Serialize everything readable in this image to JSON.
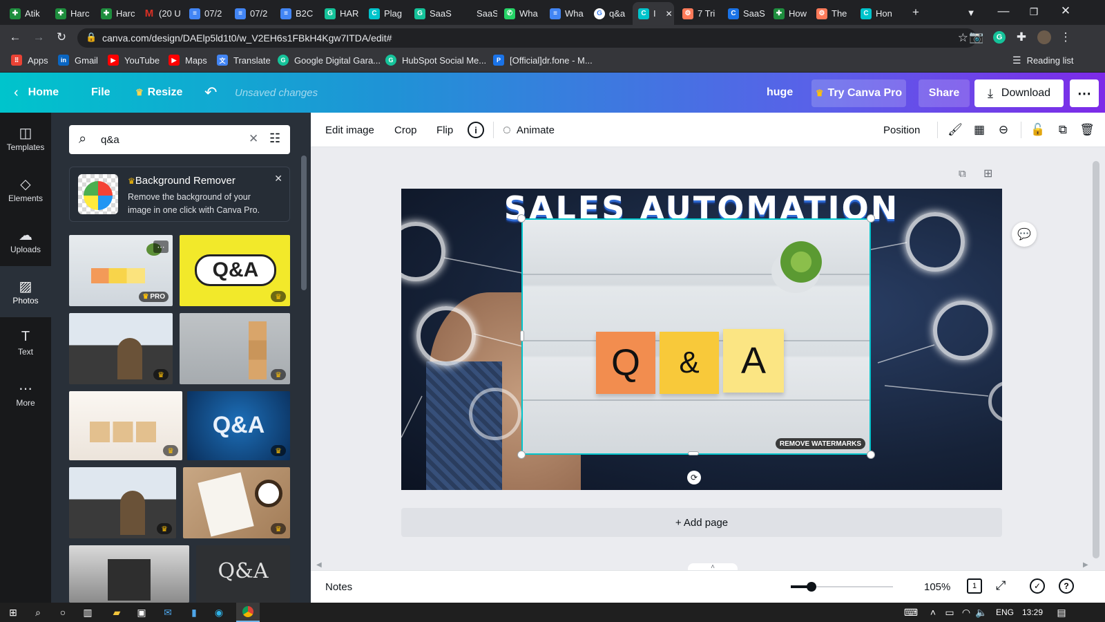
{
  "browser": {
    "tabs": [
      {
        "label": "Atik",
        "icon": "sheets-icon",
        "color": "#1e8e3e"
      },
      {
        "label": "Harc",
        "icon": "sheets-icon",
        "color": "#1e8e3e"
      },
      {
        "label": "Harc",
        "icon": "sheets-icon",
        "color": "#1e8e3e"
      },
      {
        "label": "(20 U",
        "icon": "gmail-icon",
        "color": "#d93025"
      },
      {
        "label": "07/2",
        "icon": "docs-icon",
        "color": "#4285f4"
      },
      {
        "label": "07/2",
        "icon": "docs-icon",
        "color": "#4285f4"
      },
      {
        "label": "B2C",
        "icon": "docs-icon",
        "color": "#4285f4"
      },
      {
        "label": "HAR",
        "icon": "grammarly-icon",
        "color": "#15c39a"
      },
      {
        "label": "Plag",
        "icon": "canva-icon",
        "color": "#00c4cc"
      },
      {
        "label": "SaaS",
        "icon": "grammarly-icon",
        "color": "#15c39a"
      },
      {
        "label": "SaaS",
        "icon": "blank-icon",
        "color": "#5f6368"
      },
      {
        "label": "Wha",
        "icon": "whatsapp-icon",
        "color": "#25d366"
      },
      {
        "label": "Wha",
        "icon": "docs-icon",
        "color": "#4285f4"
      },
      {
        "label": "q&a",
        "icon": "google-icon",
        "color": "#4285f4"
      },
      {
        "label": "I",
        "icon": "canva-icon",
        "color": "#00c4cc"
      },
      {
        "label": "7 Tri",
        "icon": "hubspot-icon",
        "color": "#ff7a59"
      },
      {
        "label": "SaaS",
        "icon": "canva-icon",
        "color": "#1a73e8"
      },
      {
        "label": "How",
        "icon": "sheets-icon",
        "color": "#1e8e3e"
      },
      {
        "label": "The",
        "icon": "hubspot-icon",
        "color": "#ff7a59"
      },
      {
        "label": "Hon",
        "icon": "canva-icon",
        "color": "#00c4cc"
      }
    ],
    "url": "canva.com/design/DAElp5ld1t0/w_V2EH6s1FBkH4Kgw7ITDA/edit#",
    "bookmarks": [
      {
        "label": "Apps",
        "icon": "apps-grid-icon",
        "color": "#ea4335"
      },
      {
        "label": "Gmail",
        "icon": "linkedin-icon",
        "color": "#0a66c2"
      },
      {
        "label": "YouTube",
        "icon": "youtube-icon",
        "color": "#ff0000"
      },
      {
        "label": "Maps",
        "icon": "youtube-icon",
        "color": "#ff0000"
      },
      {
        "label": "Translate",
        "icon": "translate-icon",
        "color": "#4285f4"
      },
      {
        "label": "Google Digital Gara...",
        "icon": "grammarly-icon",
        "color": "#15c39a"
      },
      {
        "label": "HubSpot Social Me...",
        "icon": "grammarly-icon",
        "color": "#15c39a"
      },
      {
        "label": "[Official]dr.fone - M...",
        "icon": "drfone-icon",
        "color": "#1a73e8"
      }
    ],
    "reading_list": "Reading list"
  },
  "canva_header": {
    "home": "Home",
    "file": "File",
    "resize": "Resize",
    "unsaved": "Unsaved changes",
    "design_name": "huge",
    "try_pro": "Try Canva Pro",
    "share": "Share",
    "download": "Download"
  },
  "rail": [
    {
      "label": "Templates",
      "icon": "templates-icon"
    },
    {
      "label": "Elements",
      "icon": "elements-icon"
    },
    {
      "label": "Uploads",
      "icon": "upload-cloud-icon"
    },
    {
      "label": "Photos",
      "icon": "photos-icon"
    },
    {
      "label": "Text",
      "icon": "text-icon"
    },
    {
      "label": "More",
      "icon": "more-dots-icon"
    }
  ],
  "panel": {
    "search_value": "q&a",
    "promo_title": "Background Remover",
    "promo_text": "Remove the background of your image in one click with Canva Pro.",
    "pro_badge": "PRO"
  },
  "context_toolbar": {
    "edit_image": "Edit image",
    "crop": "Crop",
    "flip": "Flip",
    "animate": "Animate",
    "position": "Position"
  },
  "canvas": {
    "headline": "SALES AUTOMATION",
    "tiles": [
      "Q",
      "&",
      "A"
    ],
    "watermark": "REMOVE WATERMARKS",
    "add_page": "+ Add page"
  },
  "bottom_bar": {
    "notes": "Notes",
    "zoom": "105%",
    "zoom_level": 0.2,
    "page_count": "1"
  },
  "taskbar": {
    "language": "ENG",
    "time": "13:29"
  },
  "colors": {
    "accent": "#00c4cc",
    "purple": "#7d2ae8",
    "crown": "#ffc107"
  }
}
